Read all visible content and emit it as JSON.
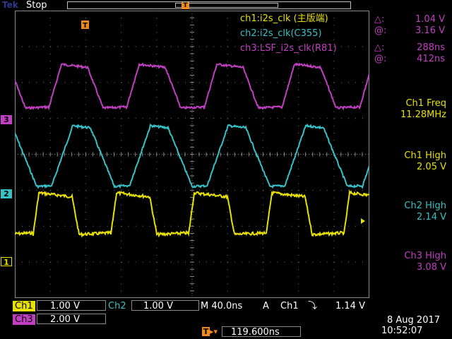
{
  "header": {
    "brand": "Tek",
    "run_state": "Stop",
    "trigger_position_marker": "T"
  },
  "legend": {
    "ch1_label": "ch1:i2s_clk (主版端)",
    "ch2_label": "ch2:i2s_clk(C355)",
    "ch3_label": "ch3:LSF_i2s_clk(R81)"
  },
  "cursors": {
    "v_delta_symbol": "△:",
    "v_delta_value": "1.04 V",
    "v_at_symbol": "@:",
    "v_at_value": "3.16 V",
    "t_delta_symbol": "△:",
    "t_delta_value": "288ns",
    "t_at_symbol": "@:",
    "t_at_value": "412ns"
  },
  "measurements": [
    {
      "title": "Ch1 Freq",
      "value": "11.28MHz",
      "color": "#e8e000"
    },
    {
      "title": "Ch1 High",
      "value": "2.05 V",
      "color": "#e8e000"
    },
    {
      "title": "Ch2 High",
      "value": "2.14 V",
      "color": "#34c3c8"
    },
    {
      "title": "Ch3 High",
      "value": "3.08 V",
      "color": "#c23ec2"
    }
  ],
  "channel_markers": {
    "ch3": "3",
    "ch2": "2",
    "ch1": "1"
  },
  "status": {
    "ch1_name": "Ch1",
    "ch1_scale": "1.00 V",
    "ch2_name": "Ch2",
    "ch2_scale": "1.00 V",
    "ch3_name": "Ch3",
    "ch3_scale": "2.00 V",
    "timebase": "M 40.0ns",
    "trigger_mode": "A",
    "trigger_source": "Ch1",
    "trigger_slope": "⤵",
    "trigger_level": "1.14 V",
    "trigger_offset": "119.600ns",
    "date": "8 Aug 2017",
    "time": "10:52:07"
  },
  "colors": {
    "ch1": "#e8e000",
    "ch2": "#34c3c8",
    "ch3": "#c23ec2",
    "trigger": "#f08a1c",
    "cursor_panel": "#c23ec2"
  }
}
